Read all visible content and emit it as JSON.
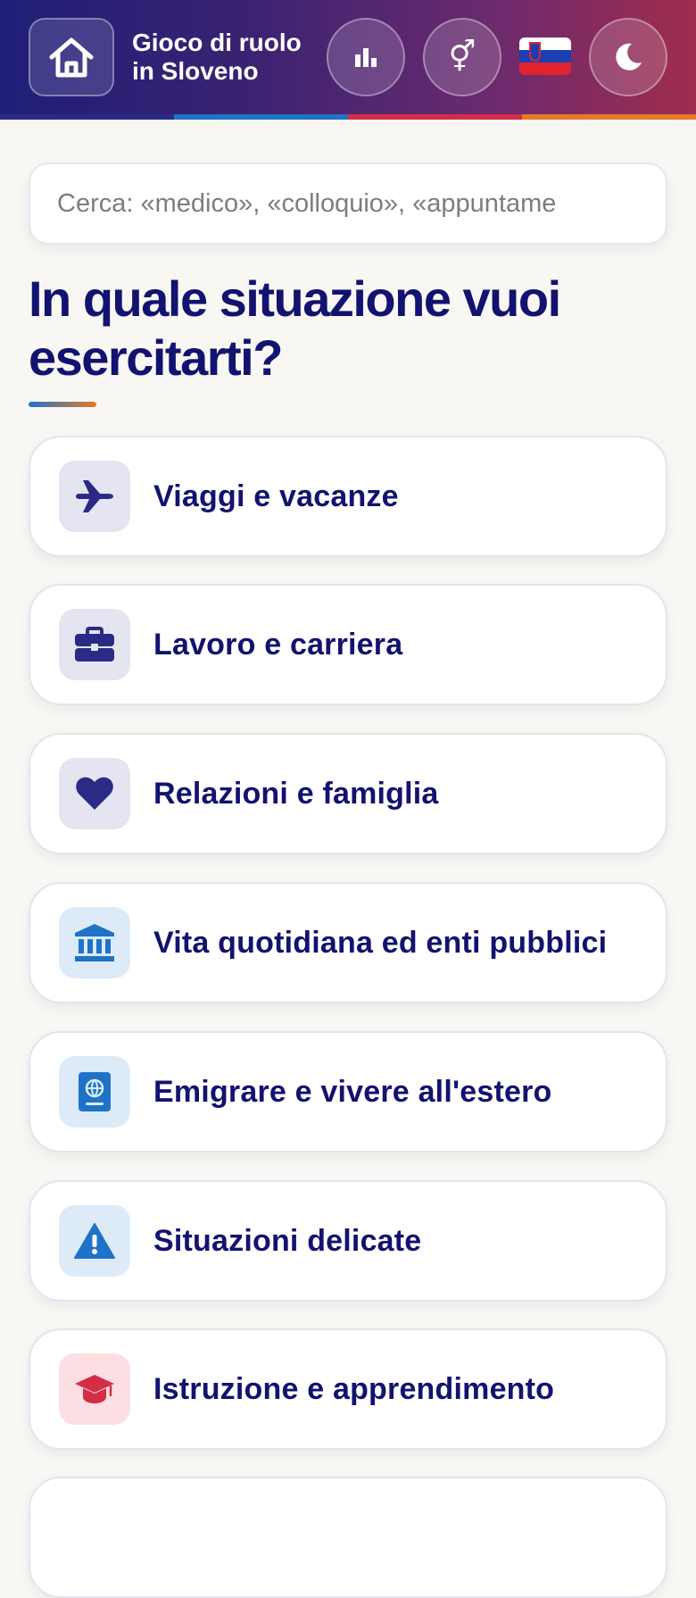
{
  "header": {
    "title": "Gioco di ruolo in Sloveno",
    "home_icon": "home-icon",
    "stats_icon": "bar-chart-icon",
    "gender_icon": "gender-symbol-icon",
    "gender_glyph": "⚥",
    "flag": "slovenia-flag",
    "theme_icon": "moon-icon"
  },
  "search": {
    "placeholder": "Cerca: «medico», «colloquio», «appuntame"
  },
  "main": {
    "heading": "In quale situazione vuoi esercitarti?",
    "categories": [
      {
        "label": "Viaggi e vacanze",
        "icon": "airplane-icon",
        "color": "#2b2b86"
      },
      {
        "label": "Lavoro e carriera",
        "icon": "briefcase-icon",
        "color": "#2b2b86"
      },
      {
        "label": "Relazioni e famiglia",
        "icon": "heart-icon",
        "color": "#2b2b86"
      },
      {
        "label": "Vita quotidiana ed enti pubblici",
        "icon": "bank-building-icon",
        "color": "#1e73c8"
      },
      {
        "label": "Emigrare e vivere all'estero",
        "icon": "passport-icon",
        "color": "#1e73c8"
      },
      {
        "label": "Situazioni delicate",
        "icon": "warning-icon",
        "color": "#1e73c8"
      },
      {
        "label": "Istruzione e apprendimento",
        "icon": "graduation-cap-icon",
        "color": "#d42e46"
      }
    ]
  },
  "colors": {
    "primary": "#121270",
    "accent_blue": "#1e73c8",
    "accent_red": "#d42e46",
    "accent_orange": "#e57a2a"
  }
}
